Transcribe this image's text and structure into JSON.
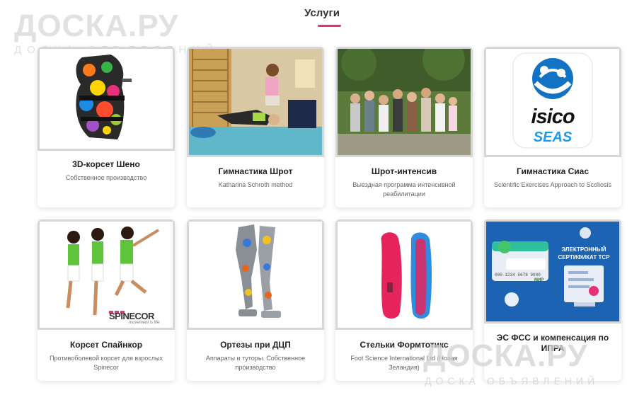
{
  "section": {
    "title": "Услуги"
  },
  "watermarks": {
    "main": "ДОСКА.РУ",
    "sub": "ДОСКА ОБЪЯВЛЕНИЙ"
  },
  "cards": [
    {
      "title": "3D-корсет Шено",
      "description": "Собственное производство",
      "image": "colorful-3d-brace-photo"
    },
    {
      "title": "Гимнастика Шрот",
      "description": "Katharina Schroth method",
      "image": "gymnastics-session-photo"
    },
    {
      "title": "Шрот-интенсив",
      "description": "Выездная программа интенсивной реабилитации",
      "image": "group-photo-outdoors"
    },
    {
      "title": "Гимнастика Сиас",
      "description": "Scientific Exercises Approach to Scoliosis",
      "image": "isico-seas-logo",
      "logo": {
        "brand": "isico",
        "sub": "SEAS"
      }
    },
    {
      "title": "Корсет Спайнкор",
      "description": "Противоболевой корсет для взрослых Spinecor",
      "image": "spinecor-models-photo",
      "logo": {
        "brand": "SPINECOR",
        "tagline": "movement is life"
      }
    },
    {
      "title": "Ортезы при ДЦП",
      "description": "Аппараты и туторы. Собственное производство",
      "image": "leg-orthoses-photo"
    },
    {
      "title": "Стельки Формтотикс",
      "description": "Foot Science International Ltd (Новая Зеландия)",
      "image": "insoles-photo"
    },
    {
      "title": "ЭС ФСС и компенсация по ИПРА",
      "description": "",
      "image": "electronic-certificate-banner",
      "banner": {
        "heading": "ЭЛЕКТРОННЫЙ СЕРТИФИКАТ ТСР",
        "card_number": "000 1234 5678 9000",
        "card_brand": "МИР"
      }
    }
  ],
  "colors": {
    "accent": "#e8307a",
    "isico_blue": "#1272c4",
    "banner_blue": "#1d63b4"
  }
}
